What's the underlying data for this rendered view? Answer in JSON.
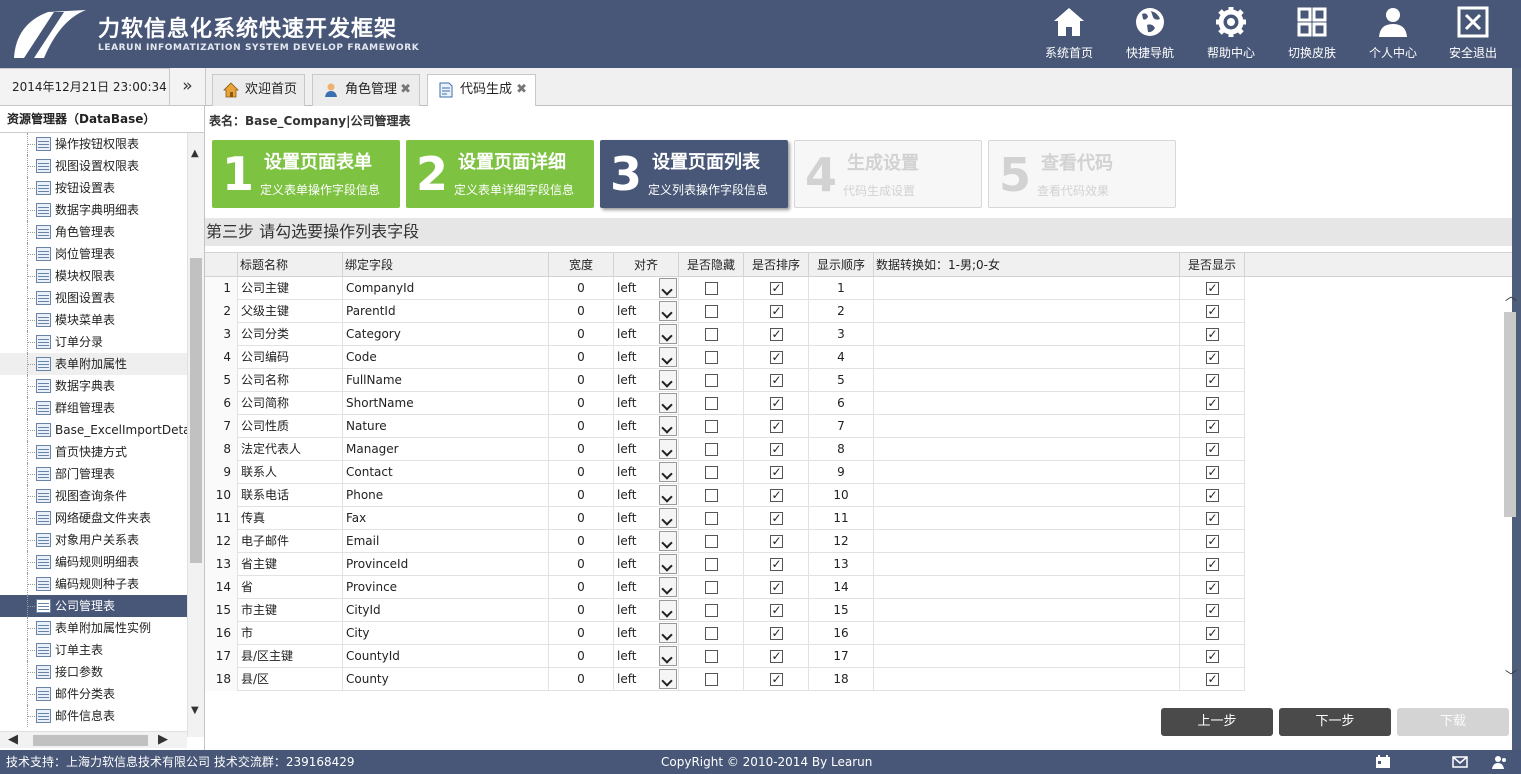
{
  "header": {
    "title": "力软信息化系统快速开发框架",
    "subtitle": "LEARUN INFOMATIZATION SYSTEM DEVELOP FRAMEWORK",
    "nav": [
      {
        "label": "系统首页",
        "icon": "home-icon"
      },
      {
        "label": "快捷导航",
        "icon": "globe-icon"
      },
      {
        "label": "帮助中心",
        "icon": "gear-icon"
      },
      {
        "label": "切换皮肤",
        "icon": "grid-icon"
      },
      {
        "label": "个人中心",
        "icon": "user-icon"
      },
      {
        "label": "安全退出",
        "icon": "close-box-icon"
      }
    ]
  },
  "datetime": "2014年12月21日 23:00:34",
  "collapse_glyph": "»",
  "tabs": [
    {
      "label": "欢迎首页",
      "icon": "house-icon",
      "closable": false
    },
    {
      "label": "角色管理",
      "icon": "person-icon",
      "closable": true
    },
    {
      "label": "代码生成",
      "icon": "document-icon",
      "closable": true,
      "active": true
    }
  ],
  "close_glyph": "✖",
  "sidebar": {
    "title": "资源管理器（DataBase）",
    "items": [
      "操作按钮权限表",
      "视图设置权限表",
      "按钮设置表",
      "数据字典明细表",
      "角色管理表",
      "岗位管理表",
      "模块权限表",
      "视图设置表",
      "模块菜单表",
      "订单分录",
      "表单附加属性",
      "数据字典表",
      "群组管理表",
      "Base_ExcelImportDetail",
      "首页快捷方式",
      "部门管理表",
      "视图查询条件",
      "网络硬盘文件夹表",
      "对象用户关系表",
      "编码规则明细表",
      "编码规则种子表",
      "公司管理表",
      "表单附加属性实例",
      "订单主表",
      "接口参数",
      "邮件分类表",
      "邮件信息表"
    ],
    "selected_index": 21,
    "hover_index": 10
  },
  "main": {
    "table_label": "表名：Base_Company|公司管理表",
    "steps": [
      {
        "num": "1",
        "name": "设置页面表单",
        "desc": "定义表单操作字段信息",
        "state": "done"
      },
      {
        "num": "2",
        "name": "设置页面详细",
        "desc": "定义表单详细字段信息",
        "state": "done"
      },
      {
        "num": "3",
        "name": "设置页面列表",
        "desc": "定义列表操作字段信息",
        "state": "current"
      },
      {
        "num": "4",
        "name": "生成设置",
        "desc": "代码生成设置",
        "state": "todo"
      },
      {
        "num": "5",
        "name": "查看代码",
        "desc": "查看代码效果",
        "state": "todo"
      }
    ],
    "step_heading": "第三步 请勾选要操作列表字段",
    "columns": [
      "标题名称",
      "绑定字段",
      "宽度",
      "对齐",
      "是否隐藏",
      "是否排序",
      "显示顺序",
      "数据转换如：1-男;0-女",
      "是否显示"
    ],
    "rows": [
      {
        "title": "公司主键",
        "field": "CompanyId",
        "width": "0",
        "align": "left",
        "hidden": false,
        "sort": true,
        "order": "1",
        "show": true
      },
      {
        "title": "父级主键",
        "field": "ParentId",
        "width": "0",
        "align": "left",
        "hidden": false,
        "sort": true,
        "order": "2",
        "show": true
      },
      {
        "title": "公司分类",
        "field": "Category",
        "width": "0",
        "align": "left",
        "hidden": false,
        "sort": true,
        "order": "3",
        "show": true
      },
      {
        "title": "公司编码",
        "field": "Code",
        "width": "0",
        "align": "left",
        "hidden": false,
        "sort": true,
        "order": "4",
        "show": true
      },
      {
        "title": "公司名称",
        "field": "FullName",
        "width": "0",
        "align": "left",
        "hidden": false,
        "sort": true,
        "order": "5",
        "show": true
      },
      {
        "title": "公司简称",
        "field": "ShortName",
        "width": "0",
        "align": "left",
        "hidden": false,
        "sort": true,
        "order": "6",
        "show": true
      },
      {
        "title": "公司性质",
        "field": "Nature",
        "width": "0",
        "align": "left",
        "hidden": false,
        "sort": true,
        "order": "7",
        "show": true
      },
      {
        "title": "法定代表人",
        "field": "Manager",
        "width": "0",
        "align": "left",
        "hidden": false,
        "sort": true,
        "order": "8",
        "show": true
      },
      {
        "title": "联系人",
        "field": "Contact",
        "width": "0",
        "align": "left",
        "hidden": false,
        "sort": true,
        "order": "9",
        "show": true
      },
      {
        "title": "联系电话",
        "field": "Phone",
        "width": "0",
        "align": "left",
        "hidden": false,
        "sort": true,
        "order": "10",
        "show": true
      },
      {
        "title": "传真",
        "field": "Fax",
        "width": "0",
        "align": "left",
        "hidden": false,
        "sort": true,
        "order": "11",
        "show": true
      },
      {
        "title": "电子邮件",
        "field": "Email",
        "width": "0",
        "align": "left",
        "hidden": false,
        "sort": true,
        "order": "12",
        "show": true
      },
      {
        "title": "省主键",
        "field": "ProvinceId",
        "width": "0",
        "align": "left",
        "hidden": false,
        "sort": true,
        "order": "13",
        "show": true
      },
      {
        "title": "省",
        "field": "Province",
        "width": "0",
        "align": "left",
        "hidden": false,
        "sort": true,
        "order": "14",
        "show": true
      },
      {
        "title": "市主键",
        "field": "CityId",
        "width": "0",
        "align": "left",
        "hidden": false,
        "sort": true,
        "order": "15",
        "show": true
      },
      {
        "title": "市",
        "field": "City",
        "width": "0",
        "align": "left",
        "hidden": false,
        "sort": true,
        "order": "16",
        "show": true
      },
      {
        "title": "县/区主键",
        "field": "CountyId",
        "width": "0",
        "align": "left",
        "hidden": false,
        "sort": true,
        "order": "17",
        "show": true
      },
      {
        "title": "县/区",
        "field": "County",
        "width": "0",
        "align": "left",
        "hidden": false,
        "sort": true,
        "order": "18",
        "show": true
      }
    ],
    "buttons": [
      {
        "label": "上一步",
        "state": "active"
      },
      {
        "label": "下一步",
        "state": "active"
      },
      {
        "label": "下载",
        "state": "disabled"
      }
    ]
  },
  "footer": {
    "left": "技术支持：上海力软信息技术有限公司    技术交流群：239168429",
    "center": "CopyRight © 2010-2014 By Learun",
    "icons": [
      "calendar-icon",
      "mail-icon",
      "users-icon"
    ]
  },
  "colors": {
    "header": "#485777",
    "step_done": "#7ec242",
    "step_current": "#485777",
    "button": "#4a4a4a"
  }
}
